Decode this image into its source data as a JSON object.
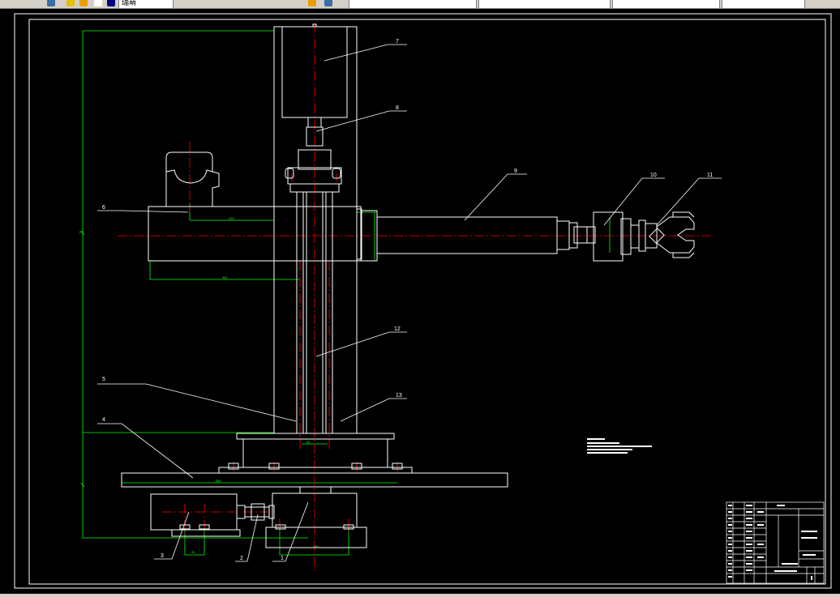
{
  "toolbar": {
    "items": [
      "瑞萌",
      "",
      "",
      "",
      "",
      ""
    ]
  },
  "callouts": [
    "1",
    "2",
    "3",
    "4",
    "5",
    "6",
    "7",
    "8",
    "9",
    "10",
    "11",
    "12",
    "13"
  ],
  "colors": {
    "frame": "#ffffff",
    "part": "#ffffff",
    "centerline": "#ff0000",
    "dimension": "#00ff00"
  }
}
